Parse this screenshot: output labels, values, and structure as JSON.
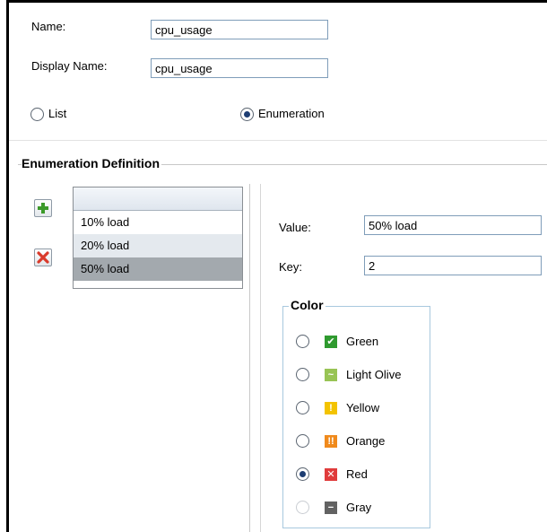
{
  "form": {
    "name_label": "Name:",
    "name_value": "cpu_usage",
    "display_name_label": "Display Name:",
    "display_name_value": "cpu_usage",
    "type_list_label": "List",
    "type_enumeration_label": "Enumeration",
    "selected_type": "Enumeration"
  },
  "enumeration": {
    "section_title": "Enumeration Definition",
    "items": [
      "10% load",
      "20% load",
      "50% load"
    ],
    "selected_item": "50% load"
  },
  "details": {
    "value_label": "Value:",
    "value": "50% load",
    "key_label": "Key:",
    "key": "2"
  },
  "color": {
    "title": "Color",
    "selected": "Red",
    "options": [
      {
        "label": "Green",
        "icon": "check-icon",
        "glyph": "✔",
        "bg": "#2f9a2f",
        "selected": false,
        "enabled": true
      },
      {
        "label": "Light Olive",
        "icon": "tilde-icon",
        "glyph": "~",
        "bg": "#98c454",
        "selected": false,
        "enabled": true
      },
      {
        "label": "Yellow",
        "icon": "exclamation-icon",
        "glyph": "!",
        "bg": "#f3c300",
        "selected": false,
        "enabled": true
      },
      {
        "label": "Orange",
        "icon": "double-exclamation-icon",
        "glyph": "!!",
        "bg": "#f08a1c",
        "selected": false,
        "enabled": true
      },
      {
        "label": "Red",
        "icon": "x-icon",
        "glyph": "✕",
        "bg": "#e03c3c",
        "selected": true,
        "enabled": true
      },
      {
        "label": "Gray",
        "icon": "minus-icon",
        "glyph": "−",
        "bg": "#5a5a5a",
        "selected": false,
        "enabled": false
      }
    ]
  },
  "colors": {
    "accent": "#1d3d72",
    "field_border": "#7f9db9",
    "list_selected_bg": "#a3a9ae",
    "list_alt_bg": "#e4e9ee",
    "add_icon": "#3c9a2a",
    "delete_icon": "#d93a2b"
  }
}
